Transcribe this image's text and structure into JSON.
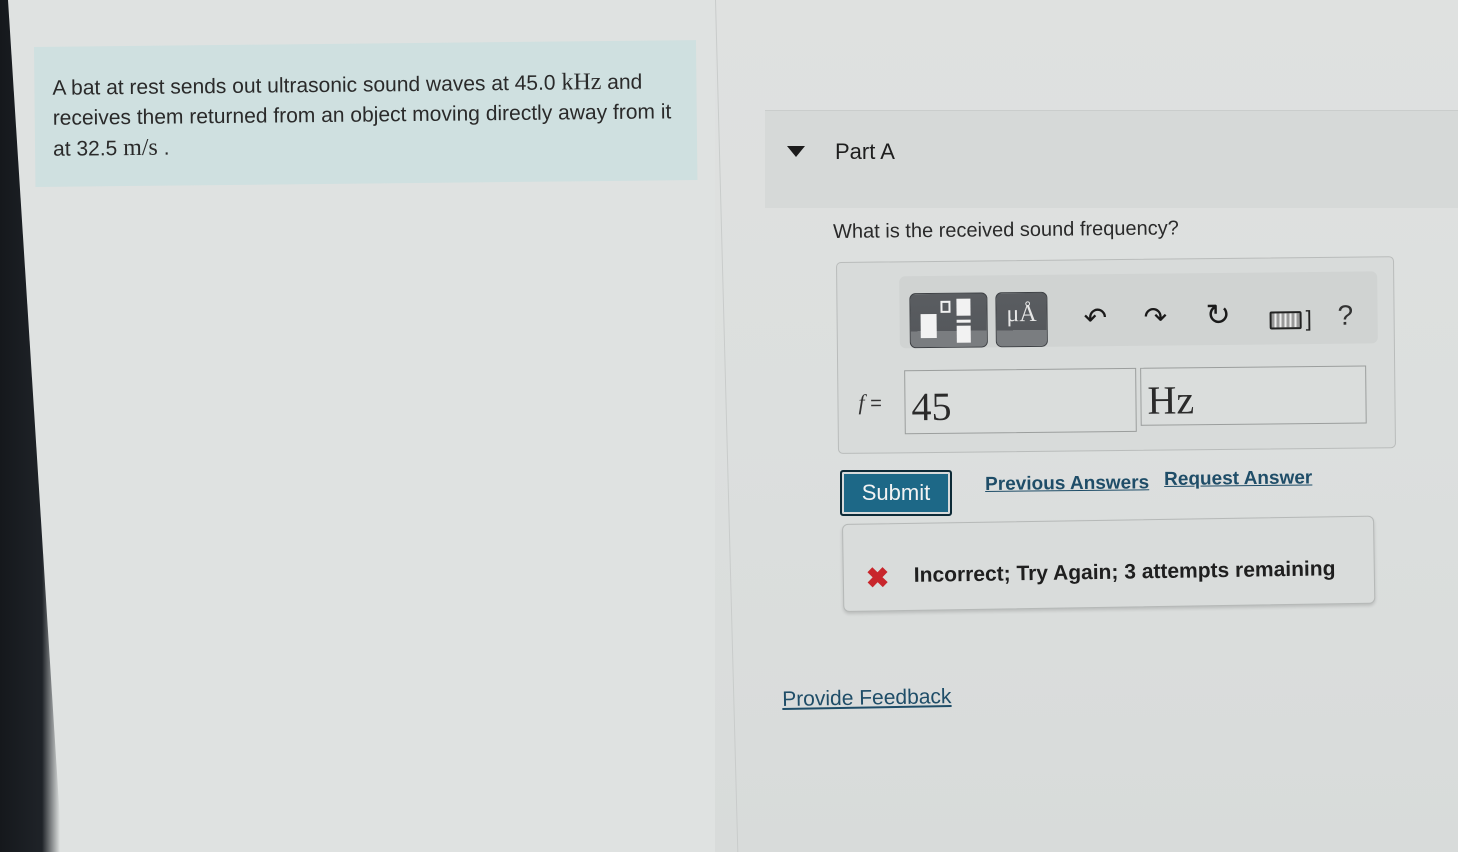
{
  "problem": {
    "text_before_freq": "A bat at rest sends out ultrasonic sound waves at 45.0 ",
    "freq_unit": "kHz",
    "text_middle": " and receives them returned from an object moving directly away from it at 32.5 ",
    "speed_unit": "m/s",
    "text_end": " ."
  },
  "part": {
    "title": "Part A",
    "question": "What is the received sound frequency?"
  },
  "toolbar": {
    "templates_icon": "templates-icon",
    "units_label": "μÅ",
    "undo_icon": "undo-icon",
    "redo_icon": "redo-icon",
    "reset_icon": "reset-icon",
    "keyboard_icon": "keyboard-icon",
    "help_label": "?"
  },
  "answer": {
    "variable": "f",
    "equals": "=",
    "value": "45",
    "unit": "Hz"
  },
  "actions": {
    "submit_label": "Submit",
    "previous_answers_label": "Previous Answers",
    "request_answer_label": "Request Answer"
  },
  "feedback": {
    "status_icon": "x-icon",
    "message": "Incorrect; Try Again; 3 attempts remaining",
    "accent_color": "#c8262c"
  },
  "footer": {
    "provide_feedback_label": "Provide Feedback"
  },
  "colors": {
    "submit_bg": "#1d6887",
    "link": "#1f4d68",
    "problem_bg": "#cfe0e0"
  }
}
